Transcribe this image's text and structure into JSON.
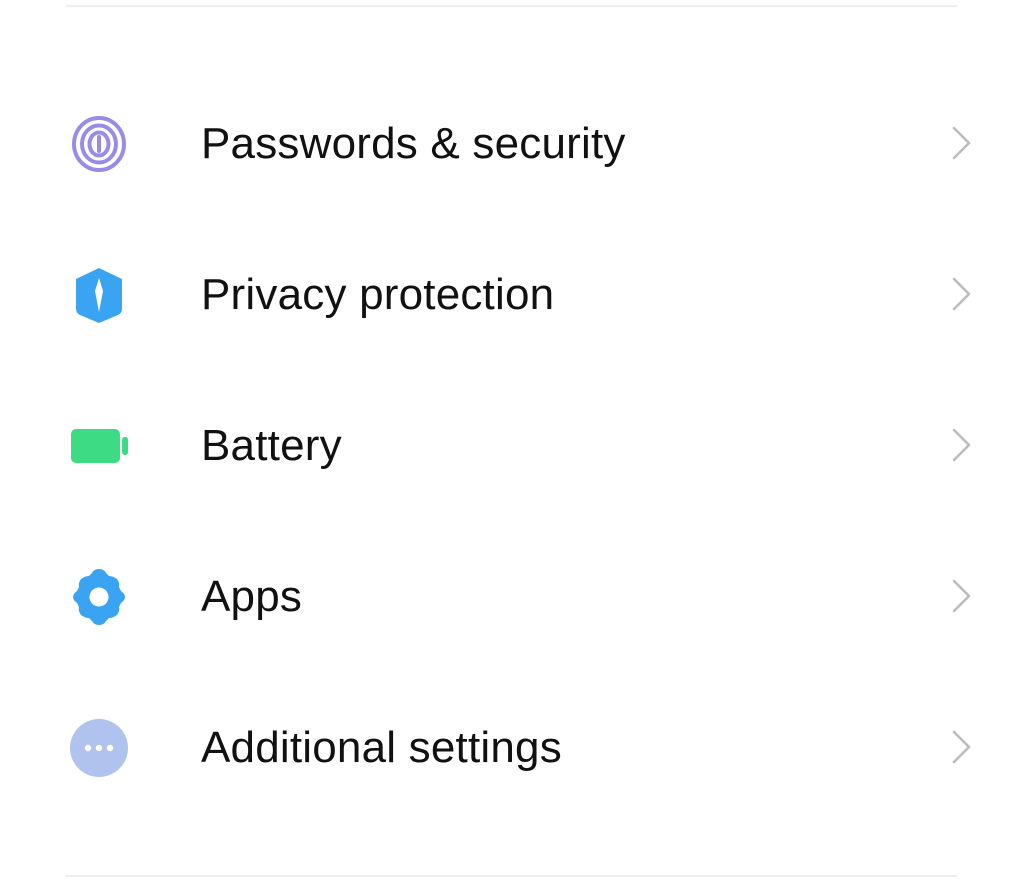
{
  "settings": {
    "items": [
      {
        "label": "Passwords & security",
        "icon": "fingerprint-icon",
        "color": "#9A8CE6"
      },
      {
        "label": "Privacy protection",
        "icon": "privacy-shield-icon",
        "color": "#3BA4F2"
      },
      {
        "label": "Battery",
        "icon": "battery-icon",
        "color": "#3DDC84"
      },
      {
        "label": "Apps",
        "icon": "apps-gear-icon",
        "color": "#3BA4F2"
      },
      {
        "label": "Additional settings",
        "icon": "more-dots-icon",
        "color": "#AFC3EE"
      }
    ]
  },
  "colors": {
    "text": "#111111",
    "chevron": "#BDBDBD",
    "divider": "#EEEEEE",
    "background": "#FFFFFF"
  }
}
